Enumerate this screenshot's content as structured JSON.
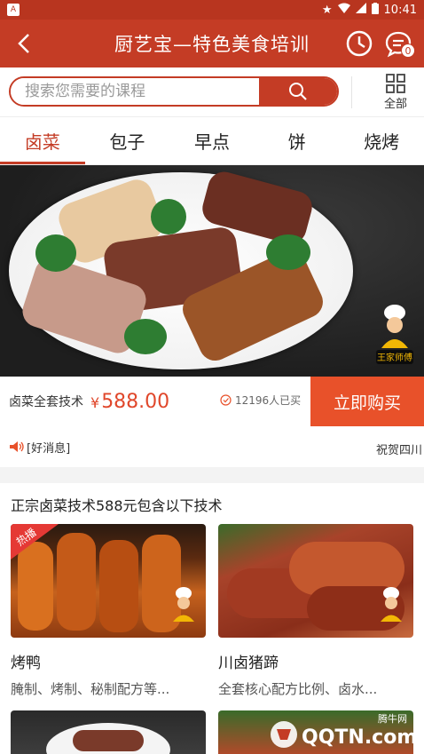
{
  "status_bar": {
    "time": "10:41"
  },
  "header": {
    "title": "厨艺宝—特色美食培训",
    "badge_count": "0"
  },
  "search": {
    "placeholder": "搜索您需要的课程",
    "all_label": "全部"
  },
  "tabs": [
    "卤菜",
    "包子",
    "早点",
    "饼",
    "烧烤"
  ],
  "banner": {
    "brand_logo_text": "王家师傅"
  },
  "product": {
    "name": "卤菜全套技术",
    "price": "588.00",
    "currency": "¥",
    "buyers": "12196人已买",
    "buy_label": "立即购买"
  },
  "notice": {
    "message": "[好消息]",
    "scroll_text": "祝贺四川"
  },
  "section": {
    "title": "正宗卤菜技术588元包含以下技术",
    "cards": [
      {
        "name": "烤鸭",
        "desc": "腌制、烤制、秘制配方等...",
        "hot_label": "热播"
      },
      {
        "name": "川卤猪蹄",
        "desc": "全套核心配方比例、卤水..."
      }
    ]
  },
  "watermark": {
    "site": "QQTN.com",
    "brand": "腾牛网"
  },
  "colors": {
    "primary": "#c43c25",
    "buy": "#e8512a",
    "price": "#e0472b"
  }
}
